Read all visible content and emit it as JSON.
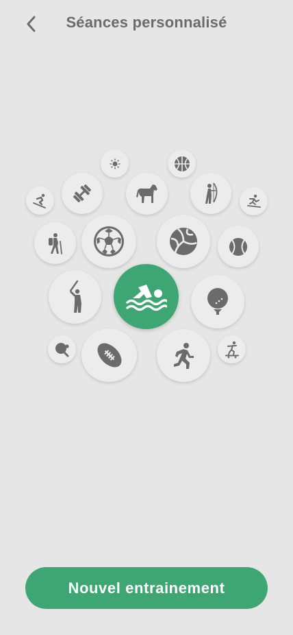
{
  "header": {
    "title": "Séances personnalisé",
    "back_icon": "chevron-left-icon"
  },
  "sports": [
    {
      "name": "sun-burst",
      "icon": "sun-icon",
      "active": false
    },
    {
      "name": "basketball",
      "icon": "basketball-icon",
      "active": false
    },
    {
      "name": "skiing",
      "icon": "skiing-icon",
      "active": false
    },
    {
      "name": "weightlifting",
      "icon": "dumbbell-icon",
      "active": false
    },
    {
      "name": "horse-riding",
      "icon": "horse-icon",
      "active": false
    },
    {
      "name": "archery",
      "icon": "archery-icon",
      "active": false
    },
    {
      "name": "snowboard",
      "icon": "snowboard-icon",
      "active": false
    },
    {
      "name": "hiking",
      "icon": "hiking-icon",
      "active": false
    },
    {
      "name": "soccer",
      "icon": "soccer-ball-icon",
      "active": false
    },
    {
      "name": "volleyball",
      "icon": "volleyball-icon",
      "active": false
    },
    {
      "name": "tennis",
      "icon": "tennis-ball-icon",
      "active": false
    },
    {
      "name": "baseball",
      "icon": "baseball-batter-icon",
      "active": false
    },
    {
      "name": "swimming",
      "icon": "swimmer-icon",
      "active": true
    },
    {
      "name": "golf",
      "icon": "golf-ball-icon",
      "active": false
    },
    {
      "name": "table-tennis",
      "icon": "ping-pong-icon",
      "active": false
    },
    {
      "name": "american-football",
      "icon": "football-icon",
      "active": false
    },
    {
      "name": "running",
      "icon": "runner-icon",
      "active": false
    },
    {
      "name": "skateboarding",
      "icon": "skateboard-icon",
      "active": false
    }
  ],
  "cta": {
    "label": "Nouvel entrainement"
  },
  "colors": {
    "accent": "#3ea672",
    "icon": "#6b6b6b",
    "bubble": "#ececec",
    "background": "#e6e6e6"
  }
}
